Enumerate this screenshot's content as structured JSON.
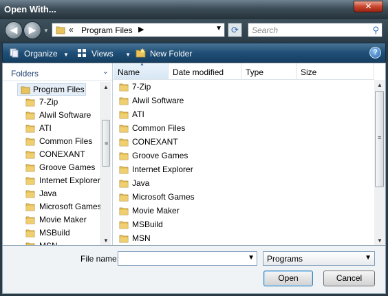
{
  "window": {
    "title": "Open With...",
    "close_glyph": "✕"
  },
  "address_bar": {
    "back_glyph": "◀",
    "forward_glyph": "▶",
    "chevron": "«",
    "path": "Program Files",
    "path_arrow": "▶",
    "search_placeholder": "Search"
  },
  "toolbar": {
    "organize_label": "Organize",
    "views_label": "Views",
    "new_folder_label": "New Folder",
    "help_label": "?"
  },
  "tree": {
    "header": "Folders",
    "root": "Program Files",
    "items": [
      "7-Zip",
      "Alwil Software",
      "ATI",
      "Common Files",
      "CONEXANT",
      "Groove Games",
      "Internet Explorer",
      "Java",
      "Microsoft Games",
      "Movie Maker",
      "MSBuild",
      "MSN"
    ]
  },
  "columns": {
    "name": "Name",
    "date_modified": "Date modified",
    "type": "Type",
    "size": "Size"
  },
  "files": [
    "7-Zip",
    "Alwil Software",
    "ATI",
    "Common Files",
    "CONEXANT",
    "Groove Games",
    "Internet Explorer",
    "Java",
    "Microsoft Games",
    "Movie Maker",
    "MSBuild",
    "MSN"
  ],
  "bottom": {
    "file_name_label": "File name:",
    "file_name_value": "",
    "file_type_selected": "Programs",
    "open_label": "Open",
    "cancel_label": "Cancel"
  },
  "colors": {
    "folder": "#e8c25a",
    "toolbar": "#1f4f77",
    "titlebar": "#3d4d58"
  }
}
